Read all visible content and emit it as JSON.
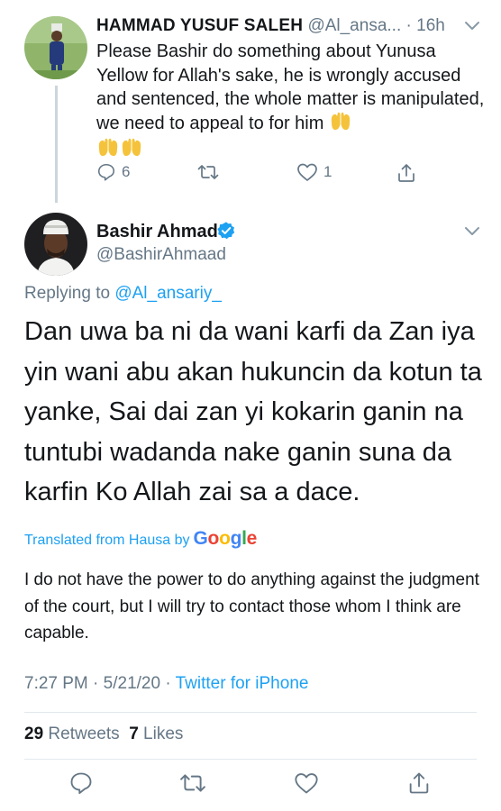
{
  "parent_tweet": {
    "display_name": "HAMMAD YUSUF SALEH",
    "handle": "@Al_ansa...",
    "separator": "·",
    "time": "16h",
    "text": "Please Bashir do something about Yunusa Yellow for Allah's sake, he is wrongly accused and sentenced, the whole matter is manipulated, we need to appeal to for him",
    "reply_count": "6",
    "like_count": "1"
  },
  "main_tweet": {
    "display_name": "Bashir Ahmad",
    "handle": "@BashirAhmaad",
    "replying_prefix": "Replying to",
    "replying_to": "@Al_ansariy_",
    "text": "Dan uwa ba ni da wani karfi da Zan iya yin wani abu akan hukuncin da kotun ta yanke, Sai dai zan yi kokarin ganin na tuntubi wadanda nake ganin suna da karfin Ko Allah zai sa a dace.",
    "translated_label": "Translated from Hausa by",
    "translator": "Google",
    "translation": "I do not have the power to do anything against the judgment of the court, but I will try to contact those whom I think are capable.",
    "time": "7:27 PM",
    "date": "5/21/20",
    "separator": "·",
    "source": "Twitter for iPhone",
    "retweet_count": "29",
    "retweet_label": "Retweets",
    "like_count": "7",
    "like_label": "Likes"
  },
  "colors": {
    "accent": "#1da1f2",
    "secondary_text": "#657786",
    "primary_text": "#14171a",
    "divider": "#e1e8ed"
  },
  "icons": [
    "chevron-down-icon",
    "reply-icon",
    "retweet-icon",
    "like-icon",
    "share-icon",
    "verified-badge-icon",
    "raised-hands-emoji"
  ]
}
